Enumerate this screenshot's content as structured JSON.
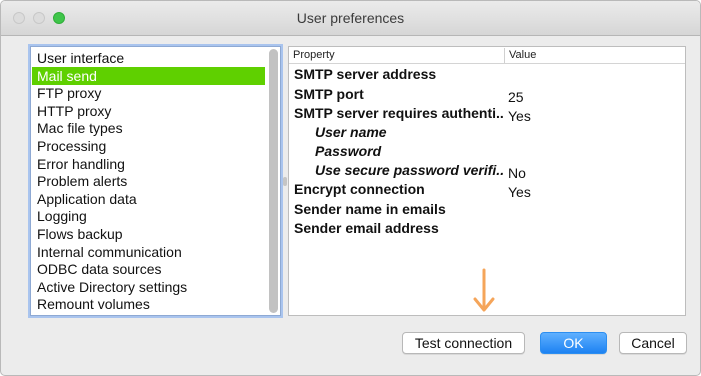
{
  "window": {
    "title": "User preferences"
  },
  "categories": [
    "User interface",
    "Mail send",
    "FTP proxy",
    "HTTP proxy",
    "Mac file types",
    "Processing",
    "Error handling",
    "Problem alerts",
    "Application data",
    "Logging",
    "Flows backup",
    "Internal communication",
    "ODBC data sources",
    "Active Directory settings",
    "Remount volumes"
  ],
  "selected_category": "Mail send",
  "properties": {
    "header": {
      "property": "Property",
      "value": "Value"
    },
    "rows": [
      {
        "name": "SMTP server address",
        "value": "",
        "indent": false
      },
      {
        "name": "SMTP port",
        "value": "25",
        "indent": false
      },
      {
        "name": "SMTP server requires authenti...",
        "value": "Yes",
        "indent": false
      },
      {
        "name": "User name",
        "value": "",
        "indent": true
      },
      {
        "name": "Password",
        "value": "",
        "indent": true
      },
      {
        "name": "Use secure password verifi...",
        "value": "No",
        "indent": true
      },
      {
        "name": "Encrypt connection",
        "value": "Yes",
        "indent": false
      },
      {
        "name": "Sender name in emails",
        "value": "",
        "indent": false
      },
      {
        "name": "Sender email address",
        "value": "",
        "indent": false
      }
    ]
  },
  "buttons": {
    "test": "Test connection",
    "ok": "OK",
    "cancel": "Cancel"
  },
  "colors": {
    "selection": "#5fd000",
    "ok_button": "#1d82f2",
    "arrow": "#f5a55a",
    "zoom_light": "#3fc54a"
  },
  "icons": {
    "arrow": "down-arrow-icon"
  }
}
